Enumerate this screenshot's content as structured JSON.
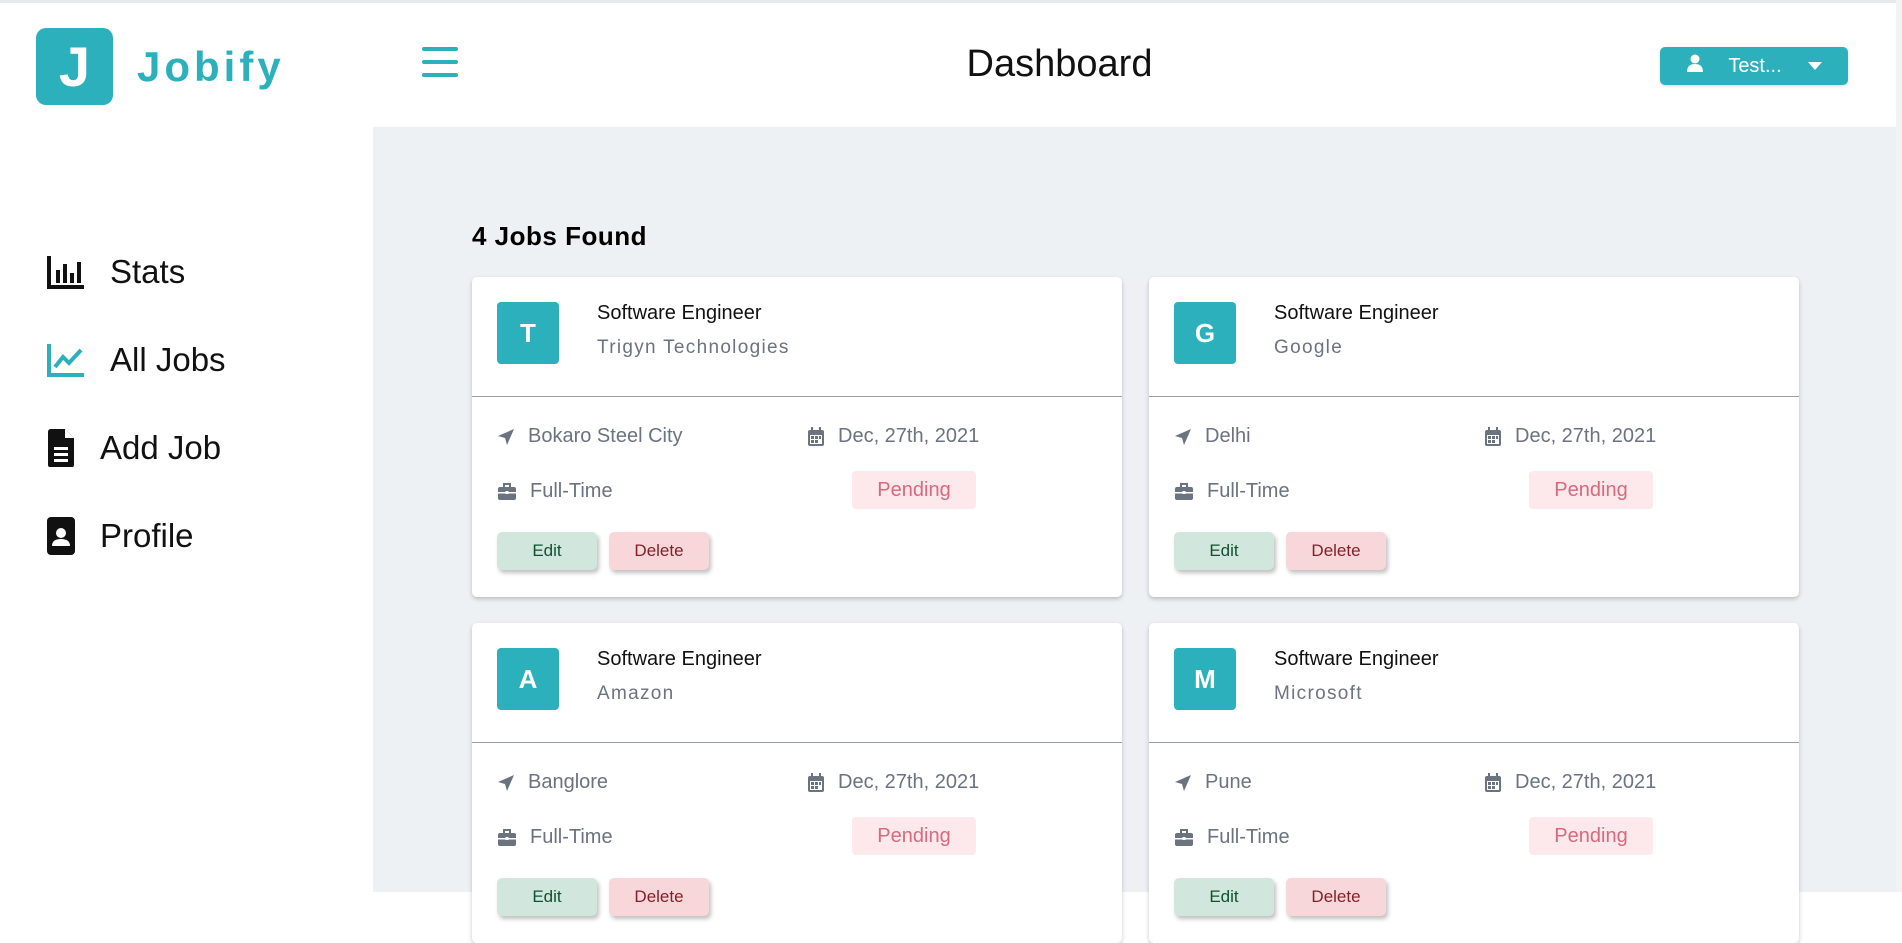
{
  "app": {
    "logo_letter": "J",
    "logo_text": "Jobify",
    "accent_color": "#2cb1bc"
  },
  "sidebar": {
    "items": [
      {
        "label": "Stats",
        "icon": "bar-chart-icon"
      },
      {
        "label": "All Jobs",
        "icon": "line-chart-icon",
        "active": true
      },
      {
        "label": "Add Job",
        "icon": "document-icon"
      },
      {
        "label": "Profile",
        "icon": "id-card-icon"
      }
    ]
  },
  "header": {
    "title": "Dashboard",
    "user_label": "Test...",
    "menu_icon": "hamburger-icon"
  },
  "main": {
    "jobs_found": "4 Jobs Found",
    "jobs": [
      {
        "initial": "T",
        "position": "Software Engineer",
        "company": "Trigyn Technologies",
        "location": "Bokaro Steel City",
        "date": "Dec, 27th, 2021",
        "type": "Full-Time",
        "status": "Pending",
        "edit_label": "Edit",
        "delete_label": "Delete"
      },
      {
        "initial": "G",
        "position": "Software Engineer",
        "company": "Google",
        "location": "Delhi",
        "date": "Dec, 27th, 2021",
        "type": "Full-Time",
        "status": "Pending",
        "edit_label": "Edit",
        "delete_label": "Delete"
      },
      {
        "initial": "A",
        "position": "Software Engineer",
        "company": "Amazon",
        "location": "Banglore",
        "date": "Dec, 27th, 2021",
        "type": "Full-Time",
        "status": "Pending",
        "edit_label": "Edit",
        "delete_label": "Delete"
      },
      {
        "initial": "M",
        "position": "Software Engineer",
        "company": "Microsoft",
        "location": "Pune",
        "date": "Dec, 27th, 2021",
        "type": "Full-Time",
        "status": "Pending",
        "edit_label": "Edit",
        "delete_label": "Delete"
      }
    ]
  }
}
